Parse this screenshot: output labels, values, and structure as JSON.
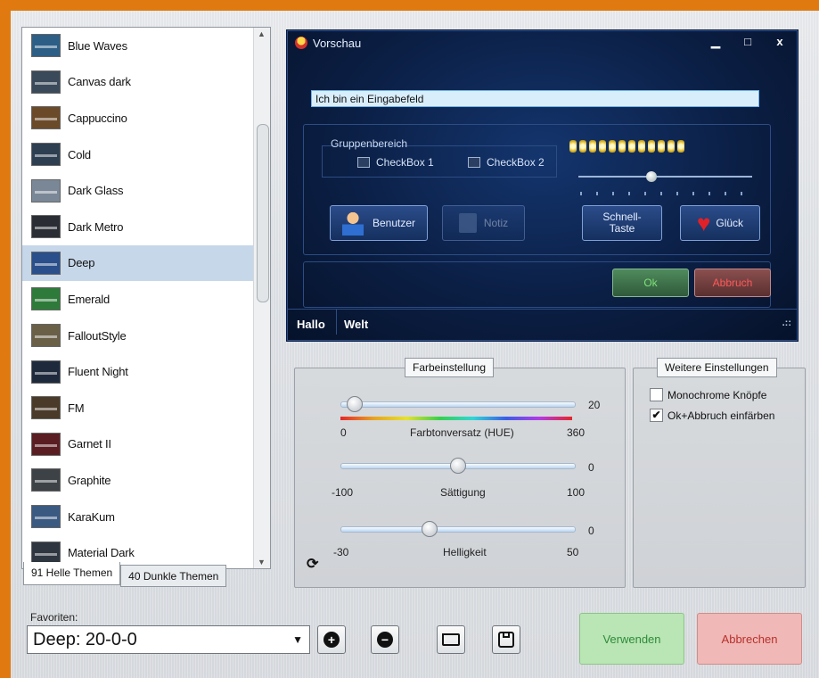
{
  "themes": [
    {
      "label": "Blue Waves",
      "thumb": "#2d5f86"
    },
    {
      "label": "Canvas dark",
      "thumb": "#3a4a5a"
    },
    {
      "label": "Cappuccino",
      "thumb": "#6b4a2a"
    },
    {
      "label": "Cold",
      "thumb": "#2f3f52"
    },
    {
      "label": "Dark Glass",
      "thumb": "#7a8796"
    },
    {
      "label": "Dark Metro",
      "thumb": "#2a2e34"
    },
    {
      "label": "Deep",
      "thumb": "#2a4f8a"
    },
    {
      "label": "Emerald",
      "thumb": "#2e7a3a"
    },
    {
      "label": "FalloutStyle",
      "thumb": "#6a6048"
    },
    {
      "label": "Fluent Night",
      "thumb": "#1e2a3c"
    },
    {
      "label": "FM",
      "thumb": "#4a3a2a"
    },
    {
      "label": "Garnet II",
      "thumb": "#5a1e22"
    },
    {
      "label": "Graphite",
      "thumb": "#3d4247"
    },
    {
      "label": "KaraKum",
      "thumb": "#3a5a82"
    },
    {
      "label": "Material Dark",
      "thumb": "#2f3640"
    }
  ],
  "selected_theme": "Deep",
  "tabs": {
    "light": "91 Helle Themen",
    "dark": "40 Dunkle Themen"
  },
  "preview": {
    "title": "Vorschau",
    "input_value": "Ich bin ein Eingabefeld",
    "group_label": "Gruppenbereich",
    "checkbox1": "CheckBox 1",
    "checkbox2": "CheckBox 2",
    "btn_user": "Benutzer",
    "btn_note": "Notiz",
    "btn_quick": "Schnell-\nTaste",
    "btn_luck": "Glück",
    "btn_ok": "Ok",
    "btn_cancel": "Abbruch",
    "status1": "Hallo",
    "status2": "Welt"
  },
  "color": {
    "legend": "Farbeinstellung",
    "hue_label": "Farbtonversatz (HUE)",
    "hue_value": "20",
    "hue_min": "0",
    "hue_max": "360",
    "sat_label": "Sättigung",
    "sat_value": "0",
    "sat_min": "-100",
    "sat_max": "100",
    "bri_label": "Helligkeit",
    "bri_value": "0",
    "bri_min": "-30",
    "bri_max": "50"
  },
  "more": {
    "legend": "Weitere Einstellungen",
    "mono_label": "Monochrome Knöpfe",
    "mono_checked": false,
    "tint_label": "Ok+Abbruch einfärben",
    "tint_checked": true
  },
  "favorites": {
    "label": "Favoriten:",
    "value": "Deep: 20-0-0"
  },
  "actions": {
    "apply": "Verwenden",
    "cancel": "Abbrechen"
  },
  "colors": {
    "accent": "#e07a10",
    "apply_bg": "#b9e6b4",
    "cancel_bg": "#f0b8b6"
  }
}
